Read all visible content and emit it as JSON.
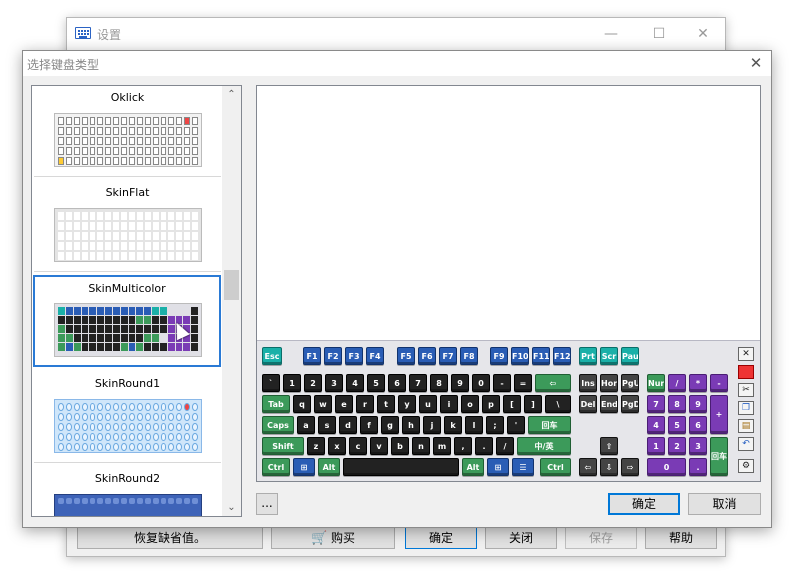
{
  "back_window": {
    "title": "设置",
    "controls": {
      "minimize": "—",
      "maximize": "☐",
      "close": "✕"
    },
    "footer": {
      "restore_defaults": "恢复缺省值。",
      "buy": "购买",
      "ok": "确定",
      "close": "关闭",
      "save": "保存",
      "help": "帮助"
    }
  },
  "dialog": {
    "title": "选择键盘类型",
    "close": "✕",
    "list": {
      "items": [
        {
          "label": "Oklick"
        },
        {
          "label": "SkinFlat"
        },
        {
          "label": "SkinMulticolor"
        },
        {
          "label": "SkinRound1"
        },
        {
          "label": "SkinRound2"
        }
      ],
      "selected_index": 2
    },
    "more_button": "...",
    "ok_button": "确定",
    "cancel_button": "取消"
  },
  "keyboard": {
    "fn_row": [
      "Esc",
      "F1",
      "F2",
      "F3",
      "F4",
      "F5",
      "F6",
      "F7",
      "F8",
      "F9",
      "F10",
      "F11",
      "F12",
      "Prt",
      "Scr",
      "Pau"
    ],
    "num_row": [
      "`",
      "1",
      "2",
      "3",
      "4",
      "5",
      "6",
      "7",
      "8",
      "9",
      "0",
      "-",
      "=",
      "⇦"
    ],
    "qwerty_row": [
      "Tab",
      "q",
      "w",
      "e",
      "r",
      "t",
      "y",
      "u",
      "i",
      "o",
      "p",
      "[",
      "]",
      "\\"
    ],
    "home_row": [
      "Caps",
      "a",
      "s",
      "d",
      "f",
      "g",
      "h",
      "j",
      "k",
      "l",
      ";",
      "'",
      "回车"
    ],
    "shift_row": [
      "Shift",
      "z",
      "x",
      "c",
      "v",
      "b",
      "n",
      "m",
      ",",
      ".",
      "/",
      "中/英"
    ],
    "bottom_row": [
      "Ctrl",
      "⊞",
      "Alt",
      "",
      "Alt",
      "⊞",
      "☰",
      "Ctrl"
    ],
    "nav_block": [
      "Ins",
      "Hor",
      "PgU",
      "Del",
      "End",
      "PgD"
    ],
    "arrows": [
      "⇧",
      "⇦",
      "⇩",
      "⇨"
    ],
    "numpad": [
      "Nur",
      "/",
      "*",
      "-",
      "7",
      "8",
      "9",
      "+",
      "4",
      "5",
      "6",
      "1",
      "2",
      "3",
      "回车",
      "0",
      "."
    ]
  },
  "colors": {
    "accent": "#0078d7",
    "selection": "#2a7ad5",
    "key_black": "#222222",
    "key_blue": "#2a5db5",
    "key_green": "#3c9a5a",
    "key_teal": "#1ab0a8",
    "key_purple": "#7a3bb5"
  }
}
